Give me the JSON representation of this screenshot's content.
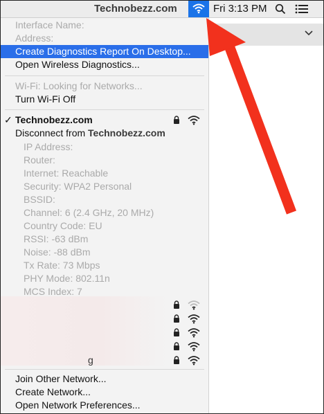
{
  "menubar": {
    "watermark": "Technobezz.com",
    "clock": "Fri 3:13 PM",
    "icons": [
      "wifi-icon",
      "search-icon",
      "notification-list-icon"
    ]
  },
  "menu": {
    "interface_name": "Interface Name:",
    "address": "Address:",
    "create_report": "Create Diagnostics Report On Desktop...",
    "open_wireless_diag": "Open Wireless Diagnostics...",
    "wifi_status": "Wi-Fi: Looking for Networks...",
    "turn_off": "Turn Wi-Fi Off",
    "connected_network": "Technobezz.com",
    "disconnect_prefix": "Disconnect from ",
    "disconnect_brand": "Technobezz.com",
    "details": [
      "IP Address:",
      "Router:",
      "Internet: Reachable",
      "Security: WPA2 Personal",
      "BSSID:",
      "Channel: 6 (2.4 GHz, 20 MHz)",
      "Country Code: EU",
      "RSSI: -63 dBm",
      "Noise: -88 dBm",
      "Tx Rate: 73 Mbps",
      "PHY Mode: 802.11n",
      "MCS Index: 7"
    ],
    "other_network_fragment": "g",
    "join_other": "Join Other Network...",
    "create_network": "Create Network...",
    "open_prefs": "Open Network Preferences..."
  },
  "colors": {
    "highlight": "#2a6ee9",
    "menubar_wifi": "#1a73e8",
    "arrow": "#f2311d"
  }
}
